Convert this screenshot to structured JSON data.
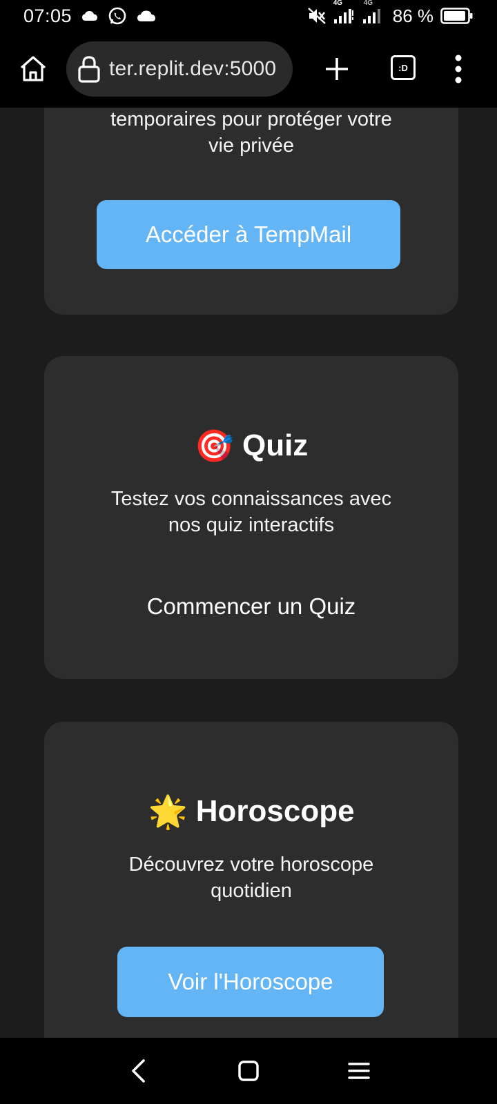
{
  "status_bar": {
    "time": "07:05",
    "network_label_1": "4G",
    "network_label_2": "4G",
    "battery": "86 %",
    "icons": [
      "cloud-icon",
      "whatsapp-icon",
      "cloud-icon",
      "mute-icon",
      "signal-icon",
      "signal-icon",
      "battery-icon"
    ]
  },
  "browser": {
    "url": "ter.replit.dev:5000",
    "tabs_label": ":D"
  },
  "cards": {
    "tempmail": {
      "description": "temporaires pour protéger votre vie privée",
      "button": "Accéder à TempMail"
    },
    "quiz": {
      "emoji": "🎯",
      "title": "Quiz",
      "description": "Testez vos connaissances avec nos quiz interactifs",
      "button": "Commencer un Quiz"
    },
    "horoscope": {
      "emoji": "🌟",
      "title": "Horoscope",
      "description": "Découvrez votre horoscope quotidien",
      "button": "Voir l'Horoscope"
    }
  },
  "colors": {
    "background": "#1c1c1c",
    "card": "#2d2d2d",
    "accent_button": "#64b5f6"
  }
}
